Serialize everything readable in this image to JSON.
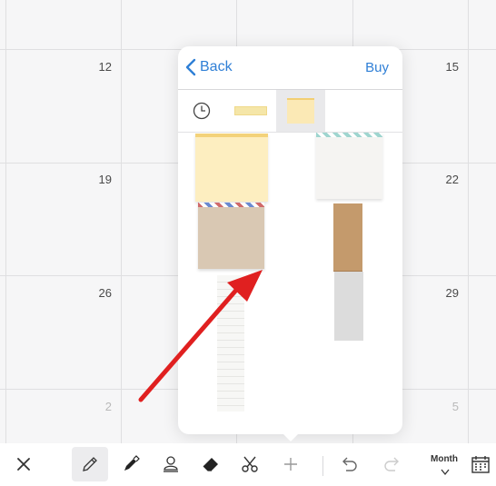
{
  "calendar": {
    "rows": [
      {
        "left": "",
        "right": ""
      },
      {
        "left": "12",
        "right": "15"
      },
      {
        "left": "19",
        "right": "22"
      },
      {
        "left": "26",
        "right": "29"
      },
      {
        "left": "2",
        "right": "5"
      }
    ]
  },
  "popover": {
    "back_label": "Back",
    "buy_label": "Buy",
    "tabs": [
      {
        "icon": "clock-icon"
      },
      {
        "icon": "tape-strip-thumbnail"
      },
      {
        "icon": "sticky-note-thumbnail"
      }
    ]
  },
  "toolbar": {
    "month_label": "Month",
    "tools": [
      "close",
      "pencil",
      "marker",
      "stamp",
      "eraser",
      "scissors",
      "add",
      "undo",
      "redo",
      "view-toggle",
      "calendar"
    ]
  },
  "annotation": {
    "arrow_color": "#e02020"
  }
}
